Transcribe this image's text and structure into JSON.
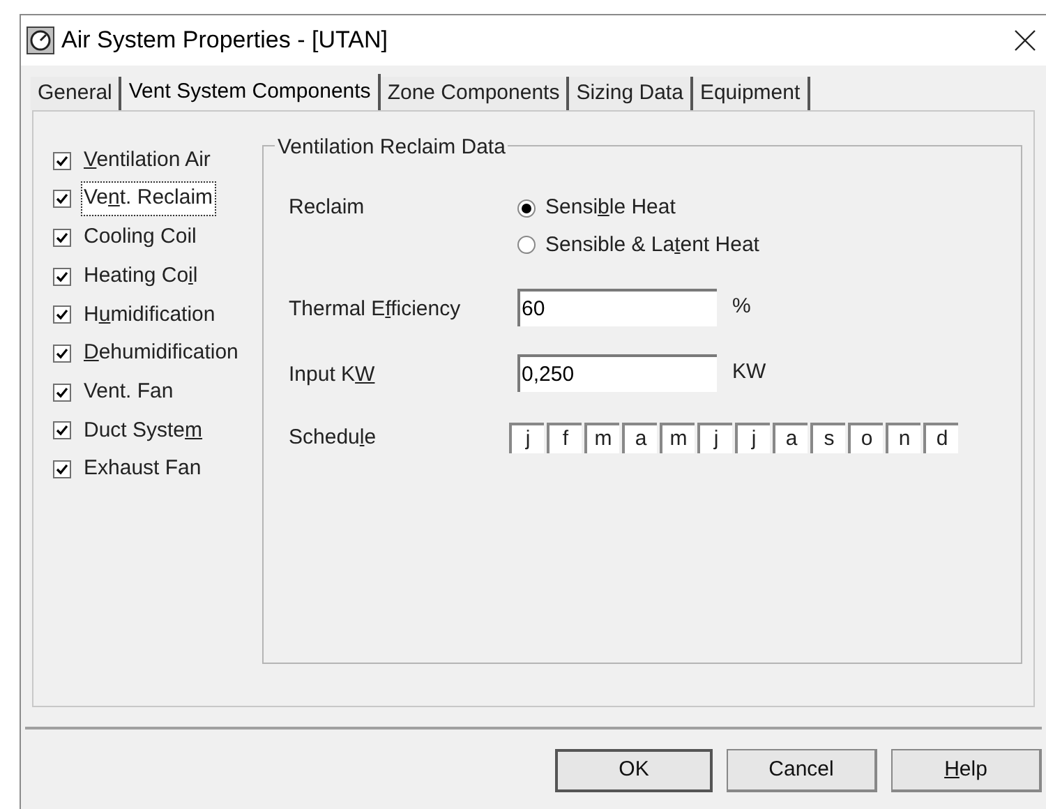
{
  "window": {
    "title": "Air System Properties - [UTAN]"
  },
  "tabs": [
    {
      "label": "General",
      "selected": false
    },
    {
      "label": "Vent System Components",
      "selected": true
    },
    {
      "label": "Zone Components",
      "selected": false
    },
    {
      "label": "Sizing Data",
      "selected": false
    },
    {
      "label": "Equipment",
      "selected": false
    }
  ],
  "components": [
    {
      "label_parts": [
        {
          "text": "V",
          "underline": true
        },
        {
          "text": "entilation Air",
          "underline": false
        }
      ],
      "checked": true,
      "focused": false
    },
    {
      "label_parts": [
        {
          "text": "Ve",
          "underline": false
        },
        {
          "text": "n",
          "underline": true
        },
        {
          "text": "t. Reclaim",
          "underline": false
        }
      ],
      "checked": true,
      "focused": true
    },
    {
      "label_parts": [
        {
          "text": "Cooling Coil",
          "underline": false
        }
      ],
      "checked": true,
      "focused": false
    },
    {
      "label_parts": [
        {
          "text": "Heating Co",
          "underline": false
        },
        {
          "text": "i",
          "underline": true
        },
        {
          "text": "l",
          "underline": false
        }
      ],
      "checked": true,
      "focused": false
    },
    {
      "label_parts": [
        {
          "text": "H",
          "underline": false
        },
        {
          "text": "u",
          "underline": true
        },
        {
          "text": "midification",
          "underline": false
        }
      ],
      "checked": true,
      "focused": false
    },
    {
      "label_parts": [
        {
          "text": "D",
          "underline": true
        },
        {
          "text": "ehumidification",
          "underline": false
        }
      ],
      "checked": true,
      "focused": false
    },
    {
      "label_parts": [
        {
          "text": "Vent. Fan",
          "underline": false
        }
      ],
      "checked": true,
      "focused": false
    },
    {
      "label_parts": [
        {
          "text": "Duct Syste",
          "underline": false
        },
        {
          "text": "m",
          "underline": true
        }
      ],
      "checked": true,
      "focused": false
    },
    {
      "label_parts": [
        {
          "text": "Exhaust Fan",
          "underline": false
        }
      ],
      "checked": true,
      "focused": false
    }
  ],
  "group": {
    "title": "Ventilation Reclaim Data",
    "reclaim": {
      "label": "Reclaim",
      "options": [
        {
          "label_parts": [
            {
              "text": "Sensi",
              "underline": false
            },
            {
              "text": "b",
              "underline": true
            },
            {
              "text": "le Heat",
              "underline": false
            }
          ],
          "selected": true
        },
        {
          "label_parts": [
            {
              "text": "Sensible & La",
              "underline": false
            },
            {
              "text": "t",
              "underline": true
            },
            {
              "text": "ent Heat",
              "underline": false
            }
          ],
          "selected": false
        }
      ]
    },
    "thermal_efficiency": {
      "label_parts": [
        {
          "text": "Thermal E",
          "underline": false
        },
        {
          "text": "f",
          "underline": true
        },
        {
          "text": "ficiency",
          "underline": false
        }
      ],
      "value": "60",
      "unit": "%"
    },
    "input_kw": {
      "label_parts": [
        {
          "text": "Input K",
          "underline": false
        },
        {
          "text": "W",
          "underline": true
        }
      ],
      "value": "0,250",
      "unit": "KW"
    },
    "schedule": {
      "label_parts": [
        {
          "text": "Schedu",
          "underline": false
        },
        {
          "text": "l",
          "underline": true
        },
        {
          "text": "e",
          "underline": false
        }
      ],
      "months": [
        "j",
        "f",
        "m",
        "a",
        "m",
        "j",
        "j",
        "a",
        "s",
        "o",
        "n",
        "d"
      ]
    }
  },
  "buttons": [
    {
      "label_parts": [
        {
          "text": "OK",
          "underline": false
        }
      ],
      "default": true
    },
    {
      "label_parts": [
        {
          "text": "Cancel",
          "underline": false
        }
      ],
      "default": false
    },
    {
      "label_parts": [
        {
          "text": "H",
          "underline": true
        },
        {
          "text": "elp",
          "underline": false
        }
      ],
      "default": false
    }
  ]
}
